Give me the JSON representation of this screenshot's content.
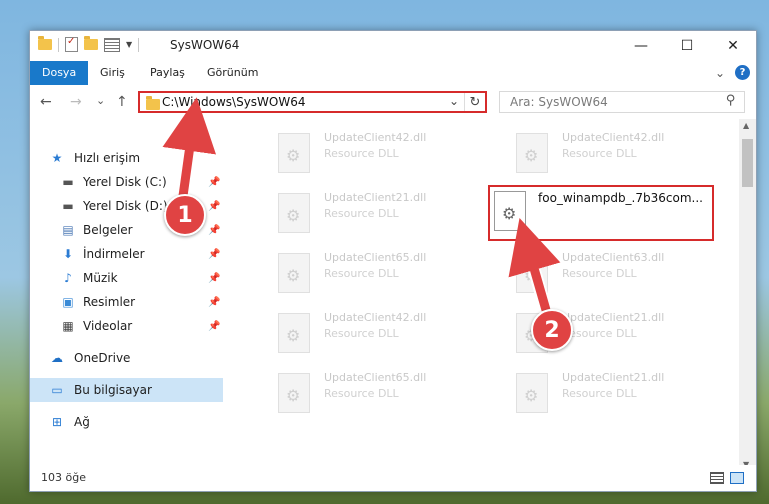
{
  "window": {
    "title": "SysWOW64",
    "controls": {
      "minimize": "—",
      "maximize": "☐",
      "close": "✕"
    }
  },
  "ribbon": {
    "tabs": [
      "Dosya",
      "Giriş",
      "Paylaş",
      "Görünüm"
    ],
    "expand_glyph": "⌄",
    "help_glyph": "?"
  },
  "nav": {
    "back": "←",
    "forward": "→",
    "recent": "⌄",
    "up": "↑",
    "address": "C:\\Windows\\SysWOW64",
    "address_drop": "⌄",
    "refresh": "↻",
    "search_placeholder": "Ara: SysWOW64",
    "search_icon": "⚲"
  },
  "sidebar": {
    "items": [
      {
        "label": "Hızlı erişim",
        "icon": "star-icon",
        "glyph": "★",
        "color": "#2b7cd3",
        "pinned": false
      },
      {
        "label": "Yerel Disk (C:)",
        "icon": "drive-icon",
        "glyph": "▬",
        "color": "#555555",
        "pinned": true
      },
      {
        "label": "Yerel Disk (D:)",
        "icon": "drive-icon",
        "glyph": "▬",
        "color": "#555555",
        "pinned": true
      },
      {
        "label": "Belgeler",
        "icon": "document-icon",
        "glyph": "▤",
        "color": "#4a77b4",
        "pinned": true
      },
      {
        "label": "İndirmeler",
        "icon": "download-icon",
        "glyph": "⬇",
        "color": "#2b7cd3",
        "pinned": true
      },
      {
        "label": "Müzik",
        "icon": "music-icon",
        "glyph": "♪",
        "color": "#2b7cd3",
        "pinned": true
      },
      {
        "label": "Resimler",
        "icon": "pictures-icon",
        "glyph": "▣",
        "color": "#3a8ad6",
        "pinned": true
      },
      {
        "label": "Videolar",
        "icon": "video-icon",
        "glyph": "▦",
        "color": "#444444",
        "pinned": true
      },
      {
        "label": "OneDrive",
        "icon": "cloud-icon",
        "glyph": "☁",
        "color": "#1f6fc5",
        "pinned": false
      },
      {
        "label": "Bu bilgisayar",
        "icon": "computer-icon",
        "glyph": "▭",
        "color": "#2b7cd3",
        "pinned": false
      },
      {
        "label": "Ağ",
        "icon": "network-icon",
        "glyph": "⊞",
        "color": "#2b7cd3",
        "pinned": false
      }
    ],
    "pin_glyph": "📌"
  },
  "files": [
    {
      "name": "UpdateClient42.dll",
      "type": "Resource DLL"
    },
    {
      "name": "UpdateClient42.dll",
      "type": "Resource DLL"
    },
    {
      "name": "UpdateClient21.dll",
      "type": "Resource DLL"
    },
    {
      "name": "foo_winampdb_.7b36com...",
      "type": ""
    },
    {
      "name": "UpdateClient65.dll",
      "type": "Resource DLL"
    },
    {
      "name": "UpdateClient63.dll",
      "type": "Resource DLL"
    },
    {
      "name": "UpdateClient42.dll",
      "type": "Resource DLL"
    },
    {
      "name": "UpdateClient21.dll",
      "type": "Resource DLL"
    },
    {
      "name": "UpdateClient65.dll",
      "type": "Resource DLL"
    },
    {
      "name": "UpdateClient21.dll",
      "type": "Resource DLL"
    }
  ],
  "status": {
    "count": "103 öğe"
  },
  "callouts": [
    "1",
    "2"
  ],
  "colors": {
    "highlight": "#d62b2b",
    "accent": "#1979ca",
    "callout": "#e04343"
  }
}
